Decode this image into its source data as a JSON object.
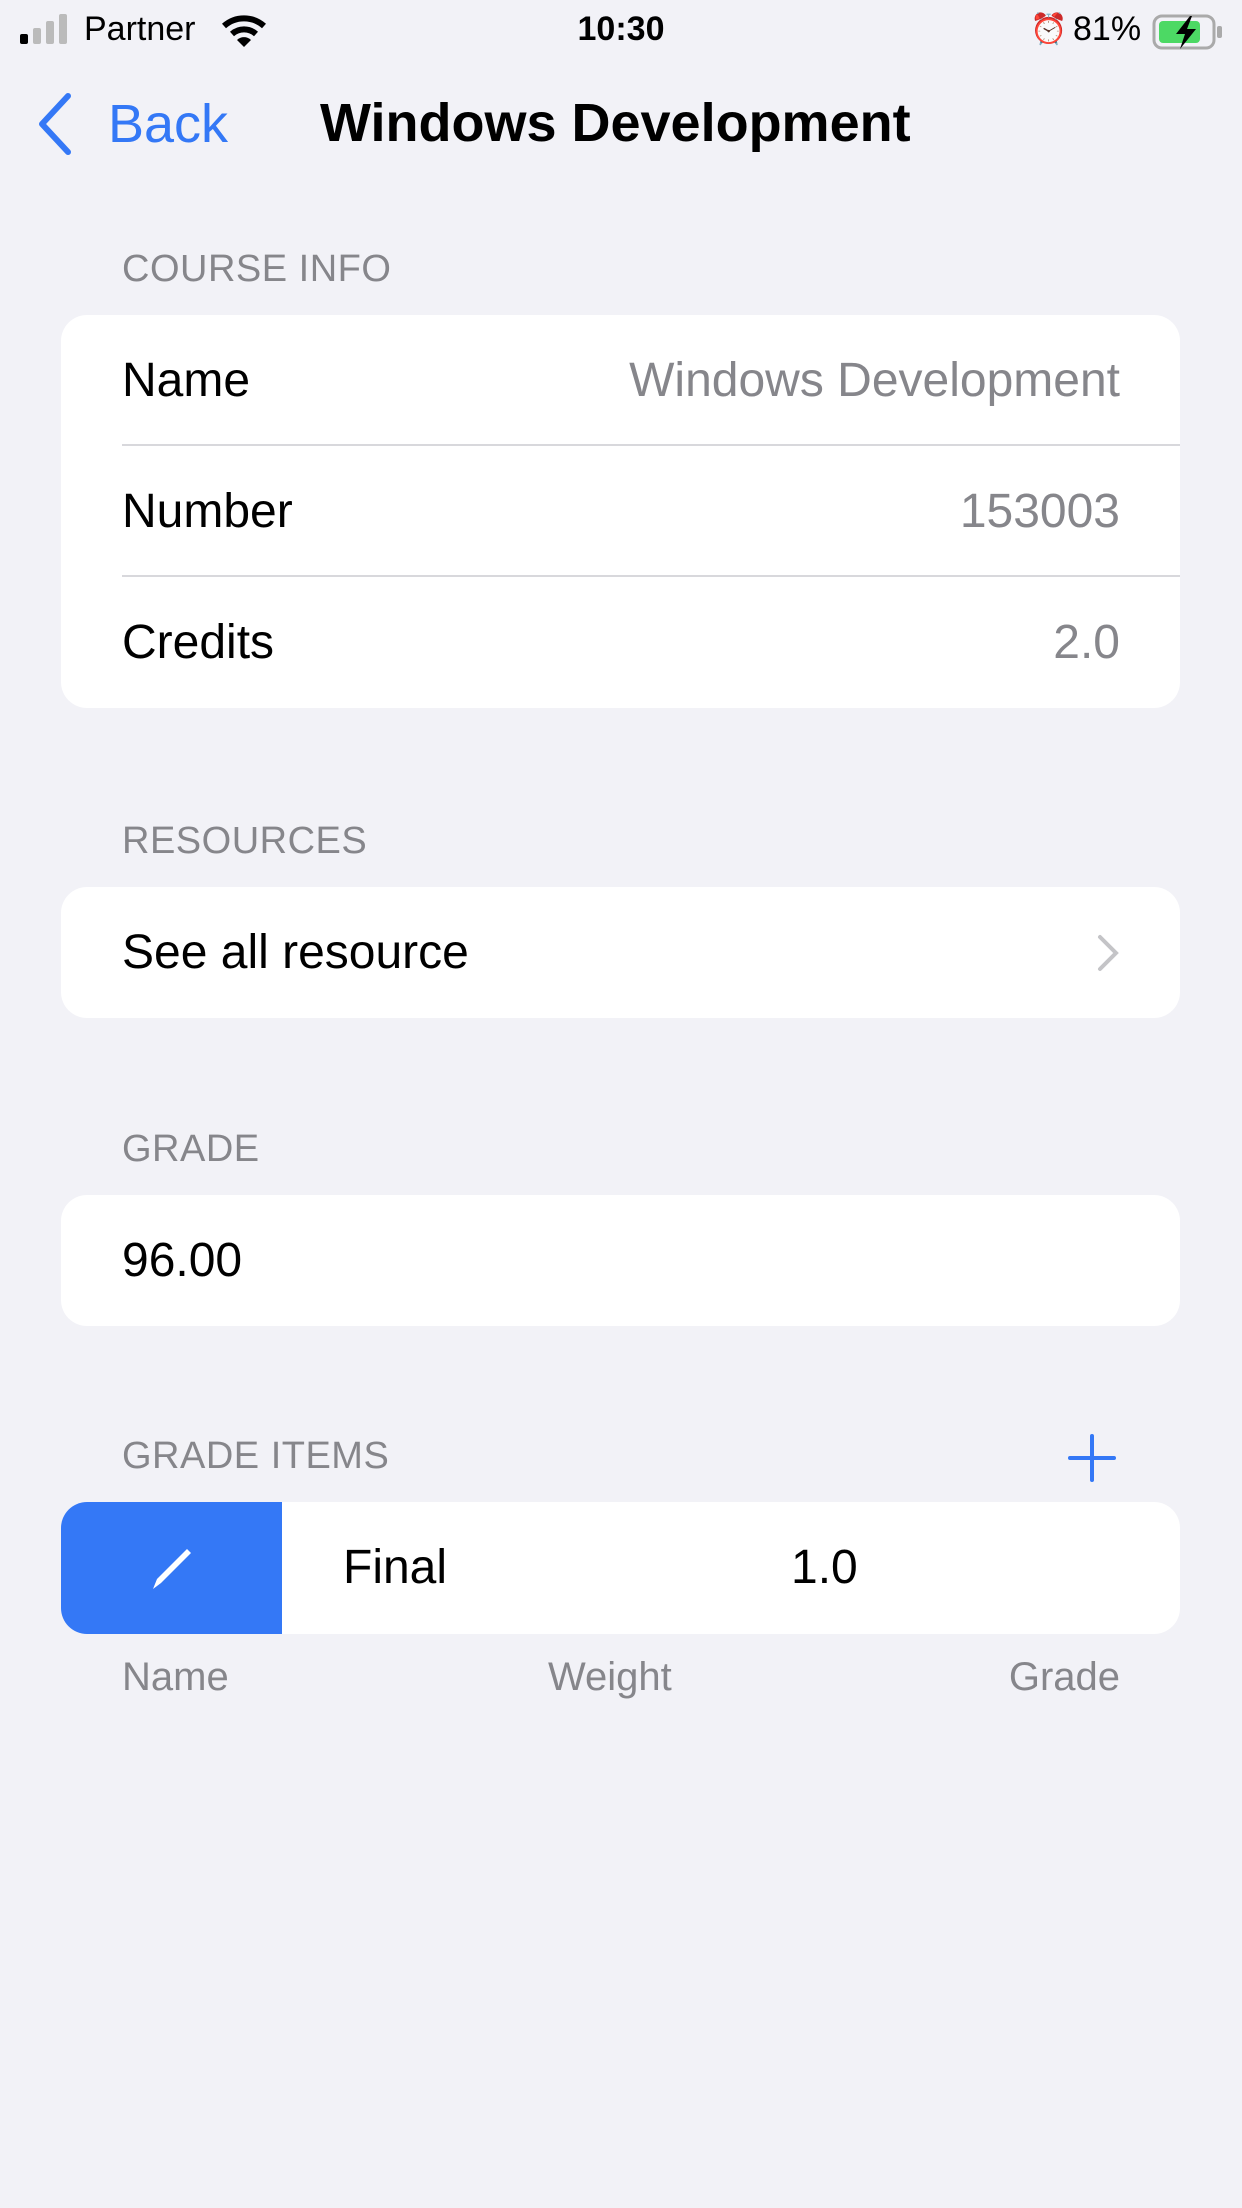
{
  "status_bar": {
    "carrier": "Partner",
    "time": "10:30",
    "battery": "81%",
    "battery_level": 81
  },
  "nav": {
    "back_label": "Back",
    "title": "Windows Development"
  },
  "course_info": {
    "header": "COURSE INFO",
    "rows": [
      {
        "label": "Name",
        "value": "Windows Development"
      },
      {
        "label": "Number",
        "value": "153003"
      },
      {
        "label": "Credits",
        "value": "2.0"
      }
    ]
  },
  "resources": {
    "header": "RESOURCES",
    "link": "See all resource"
  },
  "grade": {
    "header": "GRADE",
    "value": "96.00"
  },
  "grade_items": {
    "header": "GRADE ITEMS",
    "items": [
      {
        "name": "Final",
        "weight": "1.0",
        "grade": ""
      }
    ],
    "columns": [
      "Name",
      "Weight",
      "Grade"
    ]
  },
  "colors": {
    "accent": "#3478f6",
    "background": "#f2f2f7",
    "secondary": "#86868b"
  }
}
